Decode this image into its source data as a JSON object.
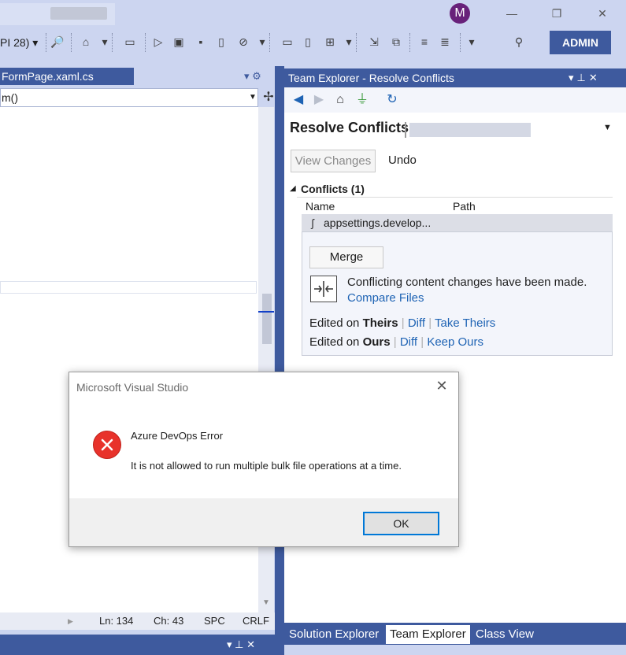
{
  "titlebar": {
    "avatar_initial": "M",
    "minimize": "—",
    "restore": "❐",
    "close": "✕"
  },
  "toolbar": {
    "api_level_combo": "PI 28) ▾",
    "admin_label": "ADMIN"
  },
  "editor": {
    "tab_label": "FormPage.xaml.cs",
    "tab_ctrls": "▾  ⚙",
    "nav_value": "m()",
    "status": {
      "line": "Ln: 134",
      "col": "Ch: 43",
      "spacing": "SPC",
      "line_ending": "CRLF"
    },
    "bottom_panel_ctrls": "▾  ⊥  ✕"
  },
  "team_explorer": {
    "header_title": "Team Explorer - Resolve Conflicts",
    "header_ctrls": "▾⊥✕",
    "page_title": "Resolve Conflicts",
    "view_changes_label": "View Changes",
    "undo_label": "Undo",
    "conflicts_header": "Conflicts (1)",
    "columns": {
      "name": "Name",
      "path": "Path"
    },
    "conflict_file": "appsettings.develop...",
    "merge_label": "Merge",
    "conflict_message": "Conflicting content changes have been made.",
    "compare_files_label": "Compare Files",
    "theirs": {
      "prefix": "Edited on ",
      "who": "Theirs",
      "diff": "Diff",
      "action": "Take Theirs"
    },
    "ours": {
      "prefix": "Edited on ",
      "who": "Ours",
      "diff": "Diff",
      "action": "Keep Ours"
    },
    "tabs": [
      {
        "label": "Solution Explorer",
        "active": false
      },
      {
        "label": "Team Explorer",
        "active": true
      },
      {
        "label": "Class View",
        "active": false
      }
    ]
  },
  "dialog": {
    "title": "Microsoft Visual Studio",
    "heading": "Azure DevOps Error",
    "message": "It is not allowed to run multiple bulk file operations at a time.",
    "ok_label": "OK"
  },
  "colors": {
    "accent": "#3e5a9e",
    "link": "#1e63b4",
    "error": "#e8322b",
    "ok_focus": "#0078d7"
  }
}
